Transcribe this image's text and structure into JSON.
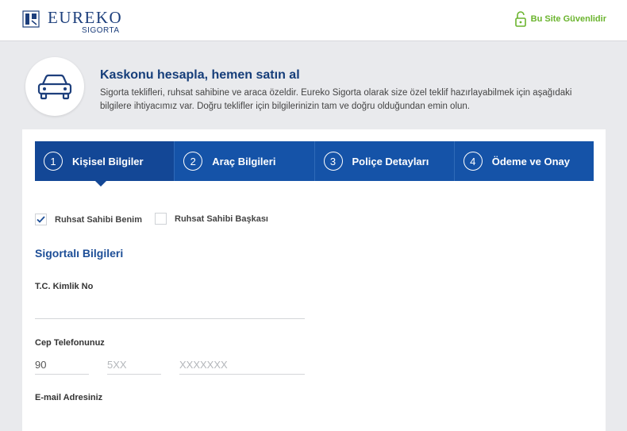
{
  "header": {
    "brand": "EUREKO",
    "brand_sub": "SIGORTA",
    "secure_text": "Bu Site Güvenlidir",
    "colors": {
      "brand": "#1d3f7c",
      "secure": "#6ab42d"
    }
  },
  "hero": {
    "icon": "car-icon",
    "title": "Kaskonu hesapla, hemen satın al",
    "description": "Sigorta teklifleri, ruhsat sahibine ve araca özeldir. Eureko Sigorta olarak size özel teklif hazırlayabilmek için aşağıdaki bilgilere ihtiyacımız var. Doğru teklifler için bilgilerinizin tam ve doğru olduğundan emin olun."
  },
  "steps": [
    {
      "num": "1",
      "label": "Kişisel Bilgiler",
      "active": true
    },
    {
      "num": "2",
      "label": "Araç Bilgileri",
      "active": false
    },
    {
      "num": "3",
      "label": "Poliçe Detayları",
      "active": false
    },
    {
      "num": "4",
      "label": "Ödeme ve Onay",
      "active": false
    }
  ],
  "form": {
    "owner_self": {
      "label": "Ruhsat Sahibi Benim",
      "checked": true
    },
    "owner_other": {
      "label": "Ruhsat Sahibi Başkası",
      "checked": false
    },
    "section_title": "Sigortalı Bilgileri",
    "tc_label": "T.C. Kimlik No",
    "tc_value": "",
    "phone_label": "Cep Telefonunuz",
    "phone_country": "90",
    "phone_area_placeholder": "5XX",
    "phone_number_placeholder": "XXXXXXX",
    "email_label": "E-mail Adresiniz"
  },
  "colors": {
    "step_bg": "#1553a8",
    "step_active": "#134796",
    "accent": "#1d4e97"
  }
}
